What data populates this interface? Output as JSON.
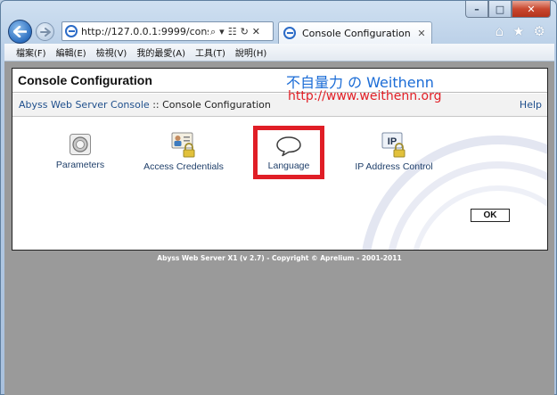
{
  "browser": {
    "address": {
      "url_main": "http://127.0.0.1:9999/conso",
      "search_glyph": "⌕",
      "dropdown_glyph": "▾",
      "compat_glyph": "☷",
      "refresh_glyph": "↻",
      "stop_glyph": "✕"
    },
    "tab": {
      "title": "Console Configuration",
      "close": "✕"
    },
    "tools": {
      "home": "⌂",
      "favorites": "★",
      "settings": "⚙"
    },
    "caption": {
      "minimize": "–",
      "maximize": "□",
      "close": "✕"
    }
  },
  "menu": [
    "檔案(F)",
    "編輯(E)",
    "檢視(V)",
    "我的最愛(A)",
    "工具(T)",
    "說明(H)"
  ],
  "console": {
    "title": "Console Configuration",
    "breadcrumb_link": "Abyss Web Server Console",
    "breadcrumb_sep": " :: ",
    "breadcrumb_current": "Console Configuration",
    "help": "Help",
    "items": [
      {
        "label": "Parameters",
        "icon": "parameters-icon"
      },
      {
        "label": "Access Credentials",
        "icon": "access-credentials-icon"
      },
      {
        "label": "Language",
        "icon": "speech-bubble-icon"
      },
      {
        "label": "IP Address Control",
        "icon": "ip-address-icon"
      }
    ],
    "ok": "OK",
    "ip_icon_text": "IP"
  },
  "overlay": {
    "brand": "不自量力 の Weithenn",
    "url": "http://www.weithenn.org"
  },
  "footer": "Abyss Web Server X1 (v 2.7) - Copyright © Aprelium - 2001-2011",
  "colors": {
    "highlight": "#e01e26",
    "brand_blue": "#1b6cd6",
    "link": "#1f4f8c"
  }
}
